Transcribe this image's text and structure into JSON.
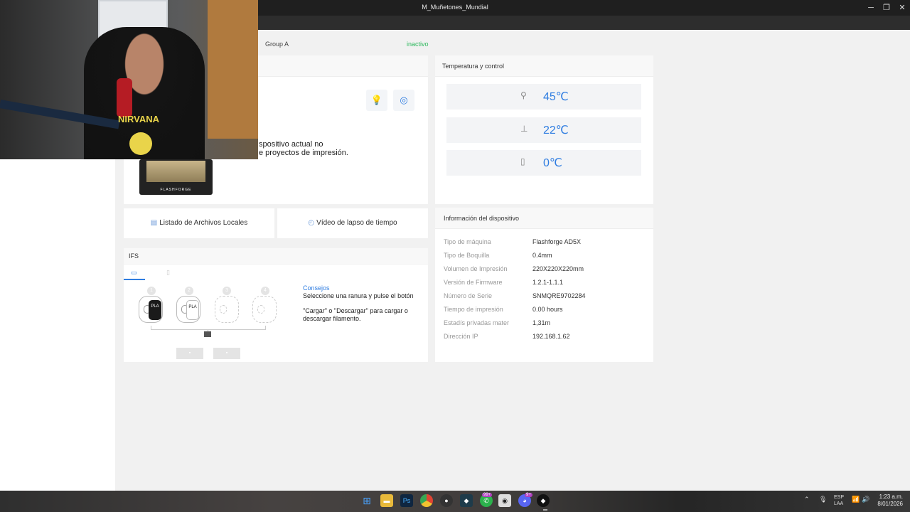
{
  "window": {
    "title": "M_Muñetones_Mundial"
  },
  "device": {
    "group": "Group A",
    "status": "inactivo",
    "status_color": "#2db85c"
  },
  "status_card": {
    "message_line1": "spositivo actual no",
    "message_line2": "e proyectos de impresión.",
    "printer_logo": "FLASHFORGE"
  },
  "temperature": {
    "title": "Temperatura y control",
    "nozzle": "45℃",
    "bed": "22℃",
    "chamber": "0℃"
  },
  "actions": {
    "local_files": "Listado de Archivos Locales",
    "timelapse": "Vídeo de lapso de tiempo"
  },
  "ifs": {
    "title": "IFS",
    "slots": [
      "1",
      "2",
      "3",
      "4"
    ],
    "spool_labels": [
      "PLA",
      "PLA"
    ],
    "tips_title": "Consejos",
    "tip_line1": "Seleccione una ranura y pulse el botón",
    "tip_line2": "\"Cargar\" o \"Descargar\" para cargar o",
    "tip_line3": "descargar filamento."
  },
  "device_info": {
    "title": "Información del dispositivo",
    "rows": [
      {
        "label": "Tipo de máquina",
        "value": "Flashforge AD5X"
      },
      {
        "label": "Tipo de Boquilla",
        "value": "0.4mm"
      },
      {
        "label": "Volumen de Impresión",
        "value": "220X220X220mm"
      },
      {
        "label": "Versión de Firmware",
        "value": "1.2.1-1.1.1"
      },
      {
        "label": "Número de Serie",
        "value": "SNMQRE9702284"
      },
      {
        "label": "Tiempo de impresión",
        "value": "0.00 hours"
      },
      {
        "label": "Estadís privadas mater",
        "value": "1,31m"
      },
      {
        "label": "Dirección IP",
        "value": "192.168.1.62"
      }
    ]
  },
  "webcam": {
    "shirt_text": "NIRVANA"
  },
  "taskbar": {
    "badge_whatsapp": "99+",
    "badge_discord": "9+",
    "language": "ESP",
    "language_sub": "LAA",
    "time": "1:23 a.m.",
    "date": "8/01/2026"
  },
  "colors": {
    "accent": "#2f7de1",
    "background": "#f1f1f1",
    "title_bar": "#1f1f1f"
  }
}
